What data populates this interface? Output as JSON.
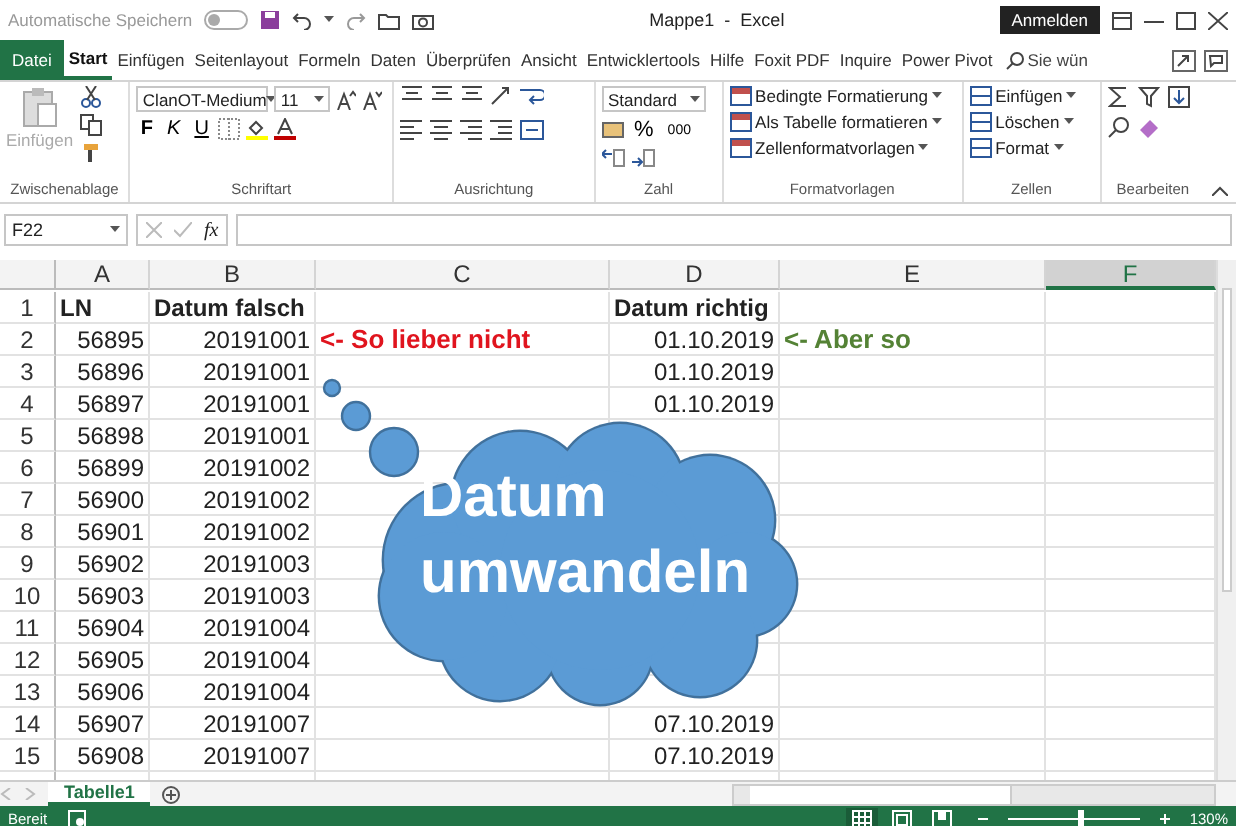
{
  "title_bar": {
    "autosave_label": "Automatische Speichern",
    "autosave_on": false,
    "title": "Mappe1  -  Excel",
    "sign_in": "Anmelden"
  },
  "ribbon_tabs": [
    {
      "label": "Datei",
      "kind": "file",
      "selected": false
    },
    {
      "label": "Start",
      "kind": "tab",
      "selected": true
    },
    {
      "label": "Einfügen",
      "kind": "tab",
      "selected": false
    },
    {
      "label": "Seitenlayout",
      "kind": "tab",
      "selected": false
    },
    {
      "label": "Formeln",
      "kind": "tab",
      "selected": false
    },
    {
      "label": "Daten",
      "kind": "tab",
      "selected": false
    },
    {
      "label": "Überprüfen",
      "kind": "tab",
      "selected": false
    },
    {
      "label": "Ansicht",
      "kind": "tab",
      "selected": false
    },
    {
      "label": "Entwicklertools",
      "kind": "tab",
      "selected": false
    },
    {
      "label": "Hilfe",
      "kind": "tab",
      "selected": false
    },
    {
      "label": "Foxit PDF",
      "kind": "tab",
      "selected": false
    },
    {
      "label": "Inquire",
      "kind": "tab",
      "selected": false
    },
    {
      "label": "Power Pivot",
      "kind": "tab",
      "selected": false
    }
  ],
  "tell_me": {
    "placeholder": "Sie wün"
  },
  "ribbon": {
    "clipboard": {
      "paste": "Einfügen",
      "paste_disabled": true,
      "label": "Zwischenablage"
    },
    "font": {
      "name": "ClanOT-Medium",
      "size": "11",
      "styles": [
        "F",
        "K",
        "U"
      ],
      "label": "Schriftart"
    },
    "alignment": {
      "label": "Ausrichtung"
    },
    "number": {
      "format": "Standard",
      "percent": "%",
      "thousands": "000",
      "label": "Zahl"
    },
    "styles": {
      "items": [
        "Bedingte Formatierung",
        "Als Tabelle formatieren",
        "Zellenformatvorlagen"
      ],
      "label": "Formatvorlagen"
    },
    "cells": {
      "items": [
        "Einfügen",
        "Löschen",
        "Format"
      ],
      "label": "Zellen"
    },
    "editing": {
      "label": "Bearbeiten"
    }
  },
  "formula_bar": {
    "name_box": "F22",
    "function_label": "fx"
  },
  "sheet": {
    "columns": [
      {
        "label": "A",
        "selected": false
      },
      {
        "label": "B",
        "selected": false
      },
      {
        "label": "C",
        "selected": false
      },
      {
        "label": "D",
        "selected": false
      },
      {
        "label": "E",
        "selected": false
      },
      {
        "label": "F",
        "selected": true
      }
    ],
    "rows": [
      {
        "number": "1",
        "header": true,
        "cells": {
          "A": "LN",
          "B": "Datum falsch",
          "D": "Datum richtig"
        }
      },
      {
        "number": "2",
        "header": false,
        "cells": {
          "A": "56895",
          "B": "20191001",
          "C": {
            "text": "<- So lieber nicht",
            "color": "#e0141e"
          },
          "D": "01.10.2019",
          "E": {
            "text": "<- Aber so",
            "color": "#548235"
          }
        }
      },
      {
        "number": "3",
        "header": false,
        "cells": {
          "A": "56896",
          "B": "20191001",
          "D": "01.10.2019"
        }
      },
      {
        "number": "4",
        "header": false,
        "cells": {
          "A": "56897",
          "B": "20191001",
          "D": "01.10.2019"
        }
      },
      {
        "number": "5",
        "header": false,
        "cells": {
          "A": "56898",
          "B": "20191001"
        }
      },
      {
        "number": "6",
        "header": false,
        "cells": {
          "A": "56899",
          "B": "20191002"
        }
      },
      {
        "number": "7",
        "header": false,
        "cells": {
          "A": "56900",
          "B": "20191002"
        }
      },
      {
        "number": "8",
        "header": false,
        "cells": {
          "A": "56901",
          "B": "20191002"
        }
      },
      {
        "number": "9",
        "header": false,
        "cells": {
          "A": "56902",
          "B": "20191003"
        }
      },
      {
        "number": "10",
        "header": false,
        "cells": {
          "A": "56903",
          "B": "20191003"
        }
      },
      {
        "number": "11",
        "header": false,
        "cells": {
          "A": "56904",
          "B": "20191004"
        }
      },
      {
        "number": "12",
        "header": false,
        "cells": {
          "A": "56905",
          "B": "20191004"
        }
      },
      {
        "number": "13",
        "header": false,
        "cells": {
          "A": "56906",
          "B": "20191004"
        }
      },
      {
        "number": "14",
        "header": false,
        "cells": {
          "A": "56907",
          "B": "20191007",
          "D": "07.10.2019"
        }
      },
      {
        "number": "15",
        "header": false,
        "cells": {
          "A": "56908",
          "B": "20191007",
          "D": "07.10.2019"
        }
      }
    ]
  },
  "cloud": {
    "caption": "Datum umwandeln"
  },
  "sheet_tabs": [
    {
      "label": "Tabelle1",
      "selected": true
    }
  ],
  "status_bar": {
    "status": "Bereit",
    "views": [
      {
        "kind": "normal",
        "selected": true
      },
      {
        "kind": "page_layout",
        "selected": false
      },
      {
        "kind": "page_break",
        "selected": false
      }
    ],
    "zoom": {
      "level": 0.55,
      "reading": "130%"
    }
  }
}
